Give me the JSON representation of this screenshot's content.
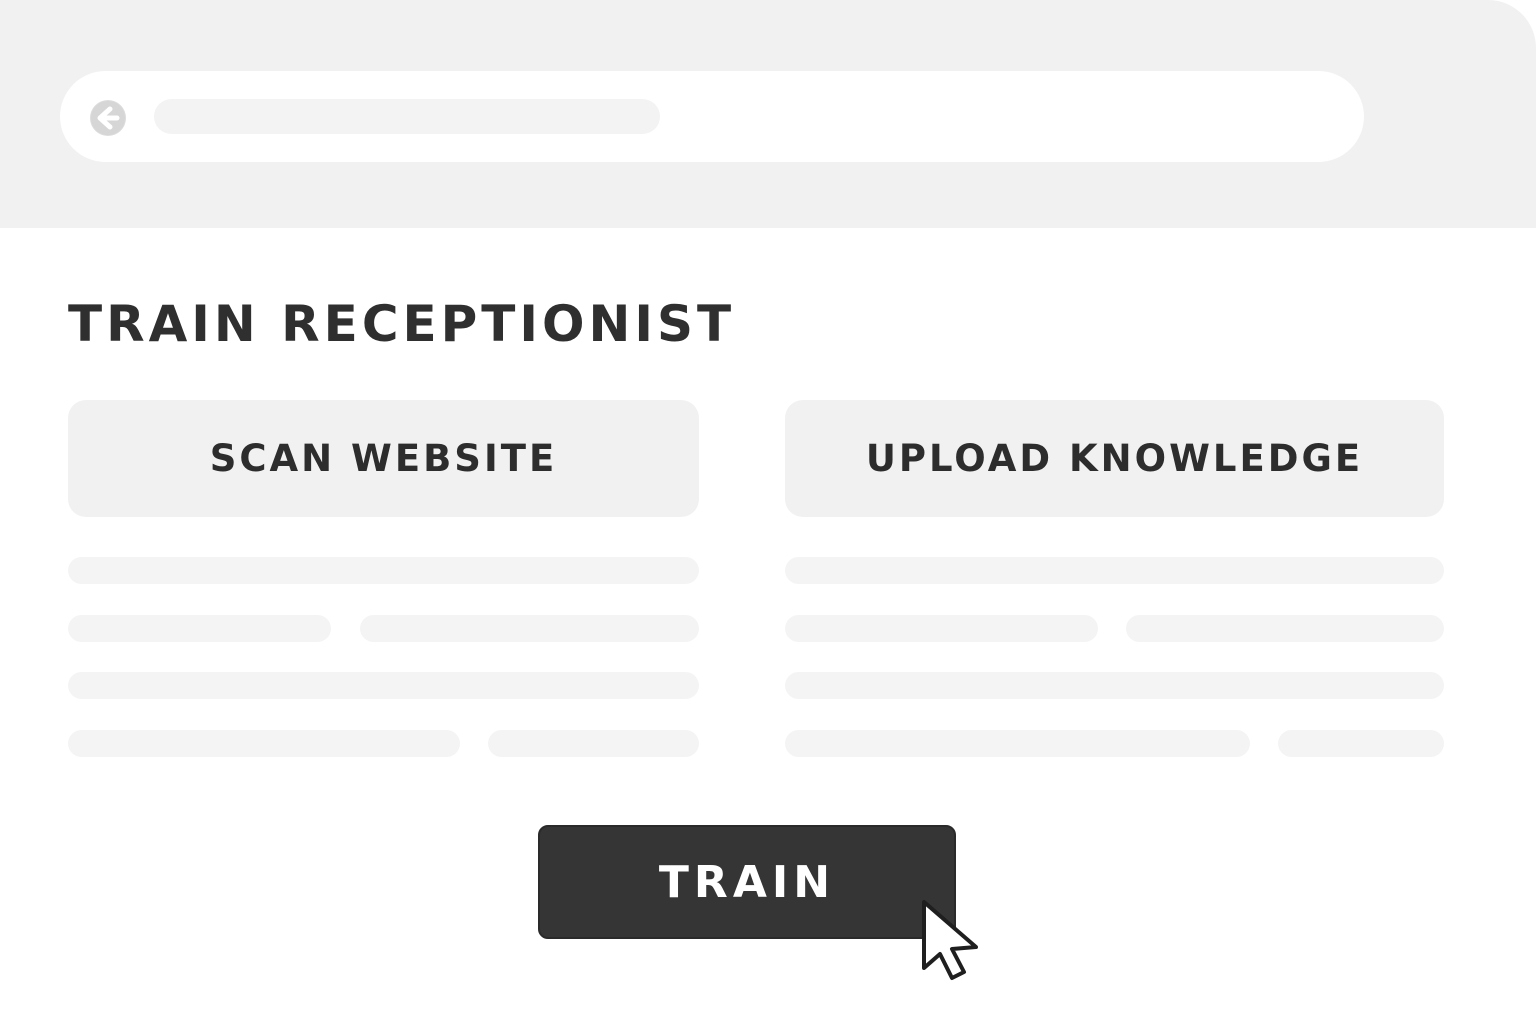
{
  "page": {
    "title": "TRAIN RECEPTIONIST"
  },
  "options": {
    "scan_label": "SCAN WEBSITE",
    "upload_label": "UPLOAD KNOWLEDGE"
  },
  "actions": {
    "train_label": "TRAIN"
  },
  "icons": {
    "back": "back-arrow-icon",
    "cursor": "mouse-pointer-icon"
  },
  "colors": {
    "topbar": "#f1f1f1",
    "card": "#f1f1f1",
    "text": "#2f2f2f",
    "primary_button": "#353535"
  }
}
